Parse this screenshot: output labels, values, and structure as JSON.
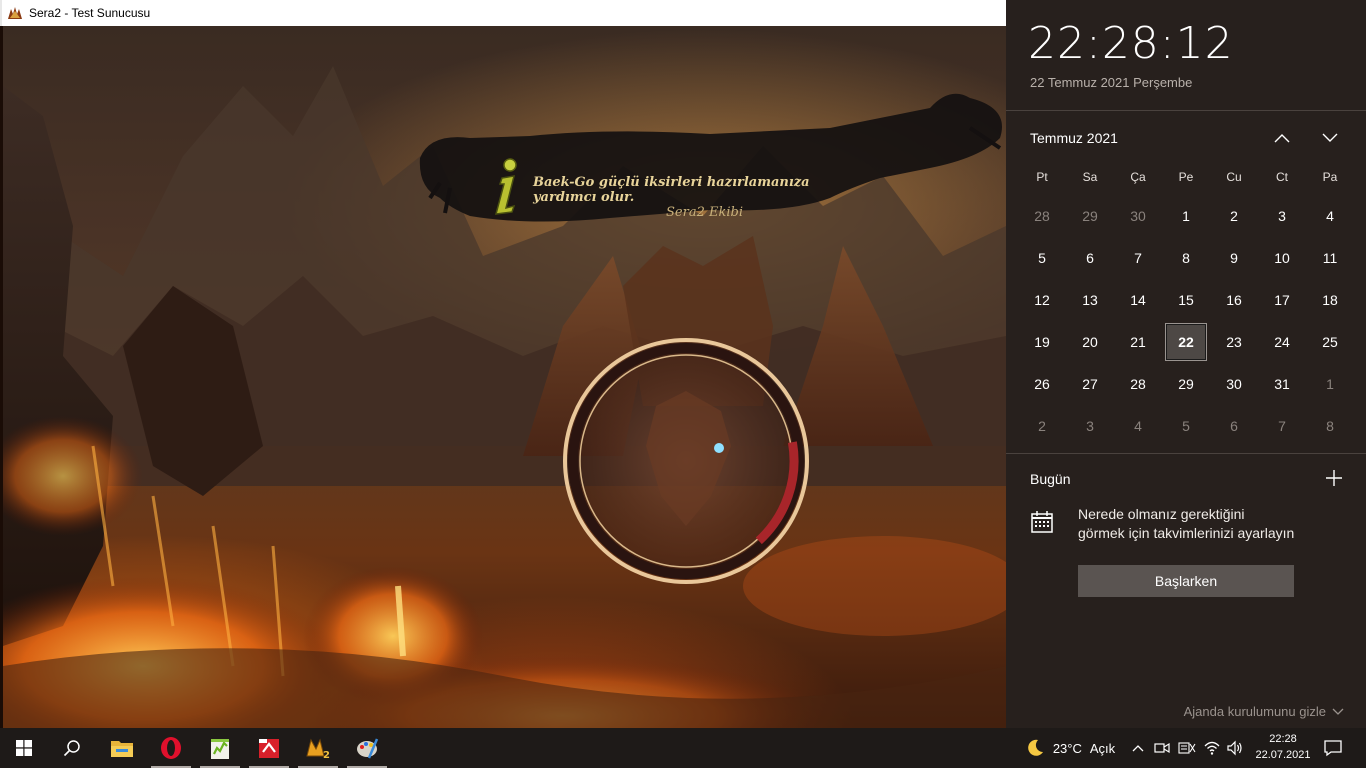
{
  "window": {
    "title": "Sera2 - Test Sunucusu"
  },
  "game": {
    "tip_text": "Baek-Go güçlü iksirleri hazırlamanıza yardımcı olur.",
    "tip_signature": "Sera2 Ekibi",
    "loading_progress": 0.16
  },
  "flyout": {
    "time": "22:28:12",
    "date_long": "22 Temmuz 2021 Perşembe",
    "month_title": "Temmuz 2021",
    "weekdays": [
      "Pt",
      "Sa",
      "Ça",
      "Pe",
      "Cu",
      "Ct",
      "Pa"
    ],
    "days": [
      {
        "d": "28",
        "other": true
      },
      {
        "d": "29",
        "other": true
      },
      {
        "d": "30",
        "other": true
      },
      {
        "d": "1"
      },
      {
        "d": "2"
      },
      {
        "d": "3"
      },
      {
        "d": "4"
      },
      {
        "d": "5"
      },
      {
        "d": "6"
      },
      {
        "d": "7"
      },
      {
        "d": "8"
      },
      {
        "d": "9"
      },
      {
        "d": "10"
      },
      {
        "d": "11"
      },
      {
        "d": "12"
      },
      {
        "d": "13"
      },
      {
        "d": "14"
      },
      {
        "d": "15"
      },
      {
        "d": "16"
      },
      {
        "d": "17"
      },
      {
        "d": "18"
      },
      {
        "d": "19"
      },
      {
        "d": "20"
      },
      {
        "d": "21"
      },
      {
        "d": "22",
        "today": true
      },
      {
        "d": "23"
      },
      {
        "d": "24"
      },
      {
        "d": "25"
      },
      {
        "d": "26"
      },
      {
        "d": "27"
      },
      {
        "d": "28"
      },
      {
        "d": "29"
      },
      {
        "d": "30"
      },
      {
        "d": "31"
      },
      {
        "d": "1",
        "other": true
      },
      {
        "d": "2",
        "other": true
      },
      {
        "d": "3",
        "other": true
      },
      {
        "d": "4",
        "other": true
      },
      {
        "d": "5",
        "other": true
      },
      {
        "d": "6",
        "other": true
      },
      {
        "d": "7",
        "other": true
      },
      {
        "d": "8",
        "other": true
      }
    ],
    "today_label": "Bugün",
    "agenda_info_line1": "Nerede olmanız gerektiğini",
    "agenda_info_line2": "görmek için takvimlerinizi ayarlayın",
    "start_button": "Başlarken",
    "hide_agenda": "Ajanda kurulumunu gizle"
  },
  "taskbar": {
    "weather_temp": "23°C",
    "weather_cond": "Açık",
    "tray_time": "22:28",
    "tray_date": "22.07.2021",
    "apps": [
      "file-explorer-icon",
      "opera-icon",
      "notepad-plus-icon",
      "red-app-icon",
      "metin2-icon",
      "paint-icon"
    ]
  }
}
